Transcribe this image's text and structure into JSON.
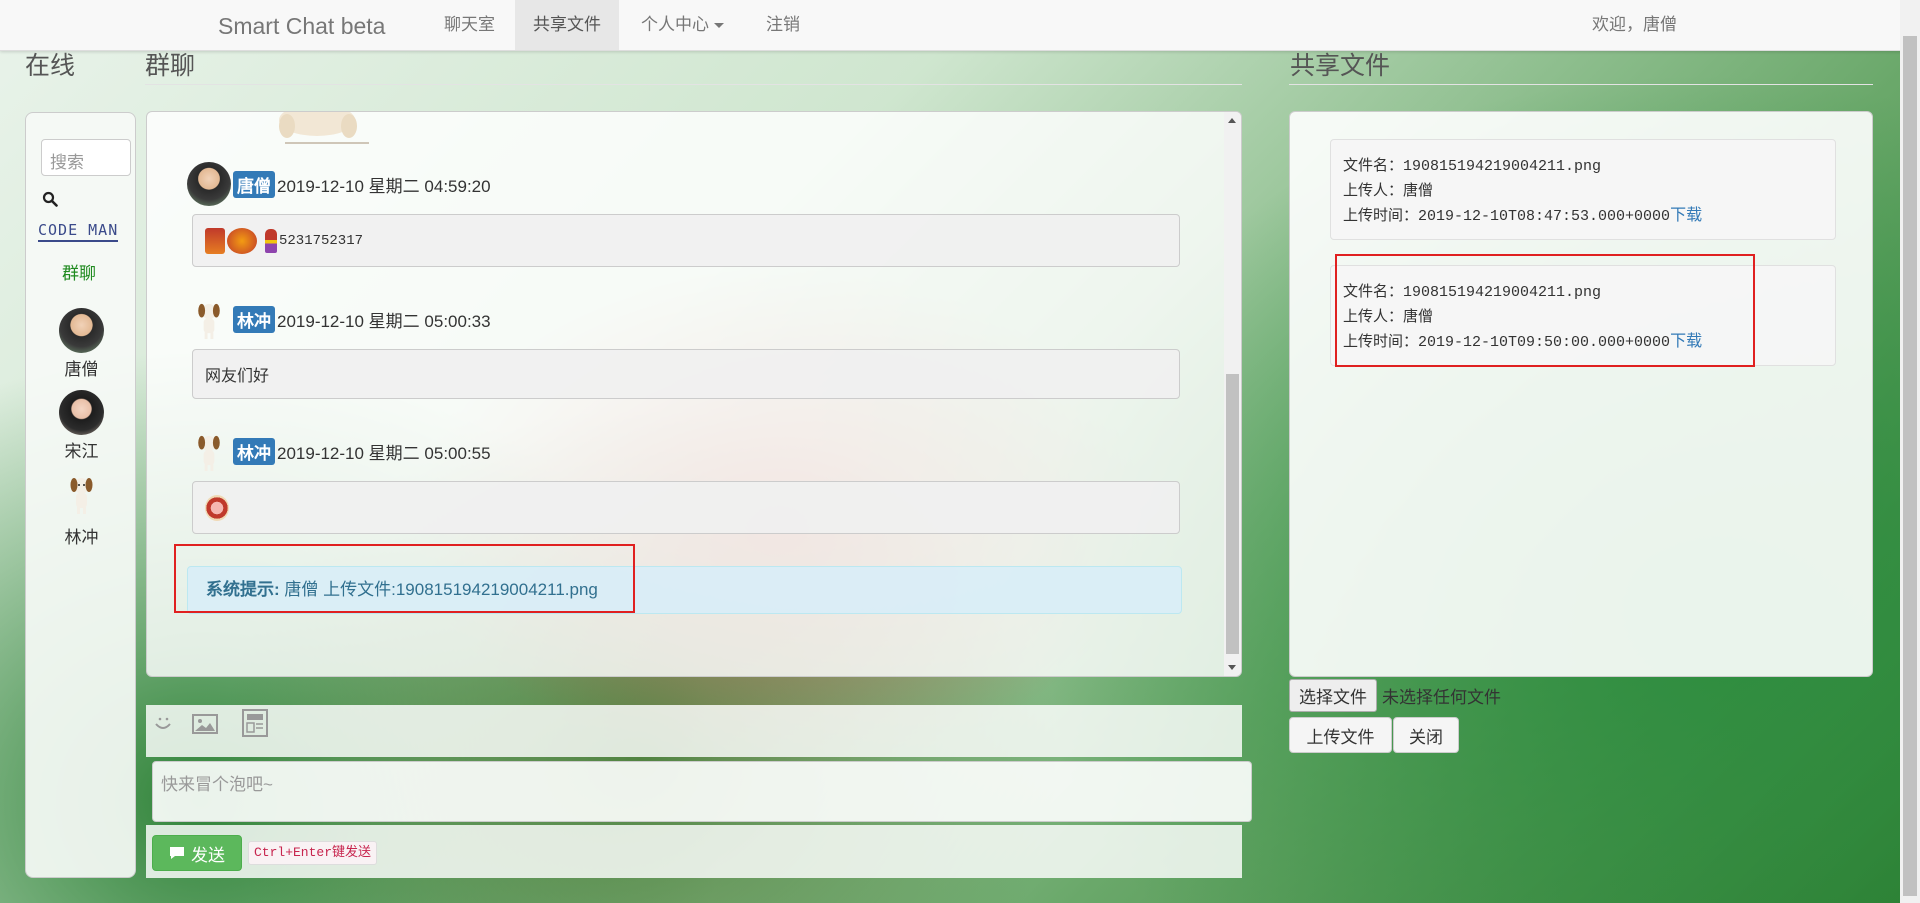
{
  "navbar": {
    "brand": "Smart Chat beta",
    "items": [
      {
        "label": "聊天室"
      },
      {
        "label": "共享文件",
        "active": true
      },
      {
        "label": "个人中心",
        "dropdown": true
      },
      {
        "label": "注销"
      }
    ],
    "welcome": "欢迎，唐僧"
  },
  "online": {
    "title": "在线",
    "search_placeholder": "搜索",
    "logo_text": "CODE MAN",
    "group_chat": "群聊",
    "users": [
      {
        "name": "唐僧"
      },
      {
        "name": "宋江"
      },
      {
        "name": "林冲"
      }
    ]
  },
  "chat": {
    "title": "群聊",
    "messages": [
      {
        "user": "唐僧",
        "time": "2019-12-10 星期二 04:59:20",
        "content": "5231752317"
      },
      {
        "user": "林冲",
        "time": "2019-12-10 星期二 05:00:33",
        "content": "网友们好"
      },
      {
        "user": "林冲",
        "time": "2019-12-10 星期二 05:00:55",
        "content": ""
      }
    ],
    "system": {
      "label": "系统提示:",
      "text": "唐僧 上传文件:190815194219004211.png"
    },
    "input_placeholder": "快来冒个泡吧~",
    "send_label": "发送",
    "send_hint": "Ctrl+Enter键发送"
  },
  "shared": {
    "title": "共享文件",
    "files": [
      {
        "name_label": "文件名：",
        "name": "190815194219004211.png",
        "uploader_label": "上传人：",
        "uploader": "唐僧",
        "time_label": "上传时间：",
        "time": "2019-12-10T08:47:53.000+0000",
        "download": "下载"
      },
      {
        "name_label": "文件名：",
        "name": "190815194219004211.png",
        "uploader_label": "上传人：",
        "uploader": "唐僧",
        "time_label": "上传时间：",
        "time": "2019-12-10T09:50:00.000+0000",
        "download": "下载"
      }
    ],
    "choose_file": "选择文件",
    "no_file": "未选择任何文件",
    "upload": "上传文件",
    "close": "关闭"
  },
  "colors": {
    "accent": "#337ab7",
    "send": "#5cb85c",
    "highlight": "#e02020"
  }
}
